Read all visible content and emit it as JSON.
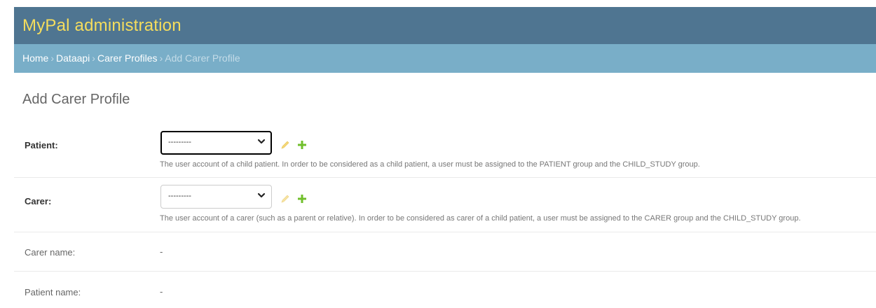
{
  "header": {
    "brand": "MyPal administration"
  },
  "breadcrumbs": {
    "items": [
      "Home",
      "Dataapi",
      "Carer Profiles"
    ],
    "separator": "›",
    "current": "Add Carer Profile"
  },
  "page": {
    "title": "Add Carer Profile"
  },
  "fields": {
    "patient": {
      "label": "Patient:",
      "selected": "---------",
      "help": "The user account of a child patient. In order to be considered as a child patient, a user must be assigned to the PATIENT group and the CHILD_STUDY group."
    },
    "carer": {
      "label": "Carer:",
      "selected": "---------",
      "help": "The user account of a carer (such as a parent or relative). In order to be considered as carer of a child patient, a user must be assigned to the CARER group and the CHILD_STUDY group."
    },
    "carer_name": {
      "label": "Carer name:",
      "value": "-"
    },
    "patient_name": {
      "label": "Patient name:",
      "value": "-"
    }
  },
  "icons": {
    "edit": "pencil-icon",
    "add": "plus-icon",
    "chevron": "chevron-down-icon"
  },
  "colors": {
    "header_bg": "#4f7591",
    "brand_text": "#f5dd5d",
    "breadcrumb_bg": "#79aec8",
    "add_icon": "#70bf2b",
    "edit_icon": "#efb80b"
  }
}
